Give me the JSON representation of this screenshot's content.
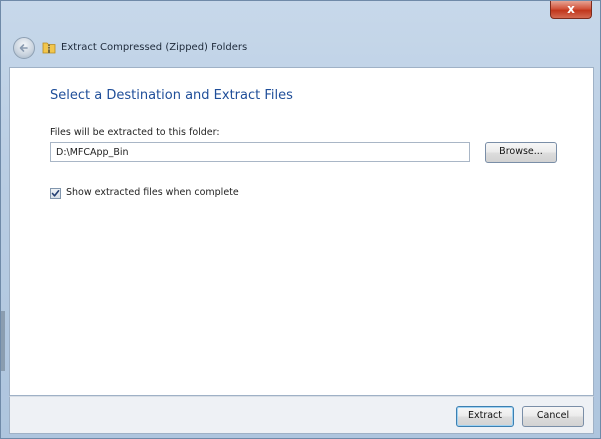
{
  "window": {
    "title": "Extract Compressed (Zipped) Folders",
    "close_glyph": "x"
  },
  "icons": {
    "back": "back-arrow-icon",
    "folder": "zip-folder-icon",
    "check": "checkmark-icon"
  },
  "content": {
    "heading": "Select a Destination and Extract Files",
    "path_label": "Files will be extracted to this folder:",
    "path_value": "D:\\MFCApp_Bin",
    "browse_label": "Browse...",
    "show_files_label": "Show extracted files when complete",
    "show_files_checked": true
  },
  "footer": {
    "extract_label": "Extract",
    "cancel_label": "Cancel"
  },
  "colors": {
    "heading": "#1f4e99",
    "frame": "#b9cde3",
    "close_button": "#c1361c"
  }
}
